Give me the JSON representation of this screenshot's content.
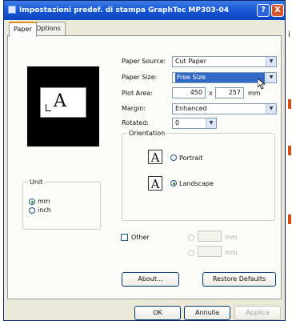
{
  "window": {
    "title": "Impostazioni predef. di stampa GraphTec MP303-04",
    "help_label": "?",
    "close_label": "X"
  },
  "tabs": [
    {
      "label": "Paper",
      "active": true
    },
    {
      "label": "Options",
      "active": false
    }
  ],
  "paper": {
    "source_label": "Paper Source:",
    "source_value": "Cut Paper",
    "size_label": "Paper Size:",
    "size_value": "Free Size",
    "plot_area_label": "Plot Area:",
    "plot_area_width": "450",
    "plot_area_x": "x",
    "plot_area_height": "257",
    "plot_area_unit": "mm",
    "margin_label": "Margin:",
    "margin_value": "Enhanced",
    "rotated_label": "Rotated:",
    "rotated_value": "0"
  },
  "preview": {
    "glyph": "A"
  },
  "orientation": {
    "legend": "Orientation",
    "portrait_glyph": "A",
    "portrait_label": "Portrait",
    "landscape_glyph": "A",
    "landscape_label": "Landscape",
    "selected": "landscape"
  },
  "unit": {
    "legend": "Unit",
    "mm_label": "mm",
    "inch_label": "inch",
    "selected": "mm"
  },
  "other": {
    "label": "Other",
    "unit1": "mm",
    "unit2": "mm"
  },
  "buttons": {
    "about": "About...",
    "restore": "Restore Defaults",
    "ok": "OK",
    "cancel": "Annulla",
    "apply": "Applica"
  },
  "colors": {
    "title_bar": "#1658d6",
    "selection": "#316ac5",
    "close_button": "#d9542b",
    "margin_text": "#d84a1a"
  },
  "icons": [
    "printer-icon",
    "help-icon",
    "close-icon",
    "mouse-cursor-icon"
  ],
  "margin_text": {
    "top_letter": "i"
  }
}
